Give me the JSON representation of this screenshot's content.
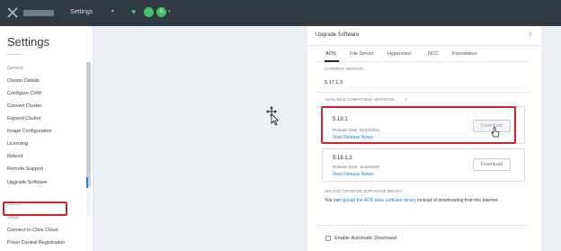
{
  "topbar": {
    "nav_title": "Settings",
    "nav_caret": "▾",
    "heart_icon": "♥",
    "alert_count": "0",
    "status_caret": "▾",
    "accent": "#43c16a",
    "background": "#2f3a45"
  },
  "sidebar": {
    "title": "Settings",
    "section_general": "General",
    "items": [
      "Cluster Details",
      "Configure CVM",
      "Convert Cluster",
      "Expand Cluster",
      "Image Configuration",
      "Licensing",
      "Reboot",
      "Remote Support",
      "Upgrade Software"
    ],
    "selected_item": "Upgrade Software",
    "section_setup": "Setup",
    "setup_items": [
      "Connect to Citrix Cloud",
      "Prism Central Registration"
    ]
  },
  "panel": {
    "title": "Upgrade Software",
    "help": "?",
    "tabs": [
      "AOS",
      "File Server",
      "Hypervisor",
      "NCC",
      "Foundation"
    ],
    "active_tab": "AOS",
    "current_version_label": "CURRENT VERSION",
    "current_version": "5.17.1.3",
    "available_label": "AVAILABLE COMPATIBLE VERSIONS",
    "available_help": "?",
    "versions": [
      {
        "version": "5.19.1",
        "release_date": "Release Date: 02/10/2021",
        "notes_link": "View Release Notes",
        "button": "Download"
      },
      {
        "version": "5.18.1.2",
        "release_date": "Release Date: 11/23/2020",
        "notes_link": "View Release Notes",
        "button": "Download"
      }
    ],
    "upload_label": "UPLOAD UPGRADE SOFTWARE BINARY",
    "upload_text_before": "You can ",
    "upload_link": "upload the AOS base software binary",
    "upload_text_after": " instead of downloading from the Internet.",
    "auto_download_label": "Enable Automatic Download"
  },
  "colors": {
    "highlight": "#d1222e",
    "link": "#1b7ed6"
  }
}
